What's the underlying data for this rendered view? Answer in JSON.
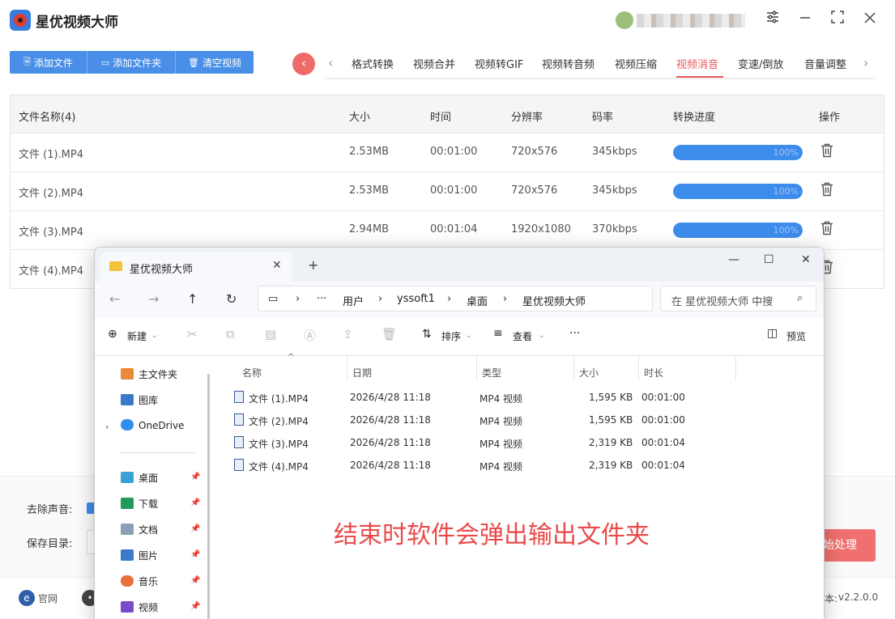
{
  "app": {
    "title": "星优视频大师",
    "toolbar": {
      "add_file": "添加文件",
      "add_folder": "添加文件夹",
      "clear_videos": "清空视频"
    },
    "tabs": [
      "格式转换",
      "视频合并",
      "视频转GIF",
      "视频转音频",
      "视频压缩",
      "视频消音",
      "变速/倒放",
      "音量调整"
    ],
    "active_tab": "视频消音",
    "table": {
      "headers": [
        "文件名称(4)",
        "大小",
        "时间",
        "分辨率",
        "码率",
        "转换进度",
        "操作"
      ],
      "rows": [
        {
          "name": "文件 (1).MP4",
          "size": "2.53MB",
          "time": "00:01:00",
          "resolution": "720x576",
          "bitrate": "345kbps",
          "progress": 1.0,
          "progress_label": "100%"
        },
        {
          "name": "文件 (2).MP4",
          "size": "2.53MB",
          "time": "00:01:00",
          "resolution": "720x576",
          "bitrate": "345kbps",
          "progress": 1.0,
          "progress_label": "100%"
        },
        {
          "name": "文件 (3).MP4",
          "size": "2.94MB",
          "time": "00:01:04",
          "resolution": "1920x1080",
          "bitrate": "370kbps",
          "progress": 1.0,
          "progress_label": "100%"
        },
        {
          "name": "文件 (4).MP4"
        }
      ]
    },
    "options": {
      "remove_audio_label": "去除声音:",
      "save_dir_label": "保存目录:"
    },
    "start_button": "始处理",
    "footer": {
      "website": "官网",
      "version": "v2.2.0.0",
      "version_prefix": "本:"
    },
    "colors": {
      "primary": "#4a8fe7",
      "accent": "#e65a5a",
      "progress": "#3d8cec",
      "note": "#ea4a4a"
    }
  },
  "explorer": {
    "tab_title": "星优视频大师",
    "breadcrumb": [
      "用户",
      "yssoft1",
      "桌面",
      "星优视频大师"
    ],
    "search_placeholder": "在 星优视频大师 中搜",
    "commands": {
      "new": "新建",
      "sort": "排序",
      "view": "查看",
      "more": "···",
      "preview": "预览"
    },
    "sidebar": {
      "top": [
        "主文件夹",
        "图库",
        "OneDrive"
      ],
      "pinned": [
        "桌面",
        "下载",
        "文档",
        "图片",
        "音乐",
        "视频"
      ]
    },
    "columns": [
      "名称",
      "日期",
      "类型",
      "大小",
      "时长"
    ],
    "files": [
      {
        "name": "文件 (1).MP4",
        "date": "2026/4/28 11:18",
        "type": "MP4 视频",
        "size": "1,595 KB",
        "duration": "00:01:00"
      },
      {
        "name": "文件 (2).MP4",
        "date": "2026/4/28 11:18",
        "type": "MP4 视频",
        "size": "1,595 KB",
        "duration": "00:01:00"
      },
      {
        "name": "文件 (3).MP4",
        "date": "2026/4/28 11:18",
        "type": "MP4 视频",
        "size": "2,319 KB",
        "duration": "00:01:04"
      },
      {
        "name": "文件 (4).MP4",
        "date": "2026/4/28 11:18",
        "type": "MP4 视频",
        "size": "2,319 KB",
        "duration": "00:01:04"
      }
    ]
  },
  "annotation": "结束时软件会弹出输出文件夹"
}
